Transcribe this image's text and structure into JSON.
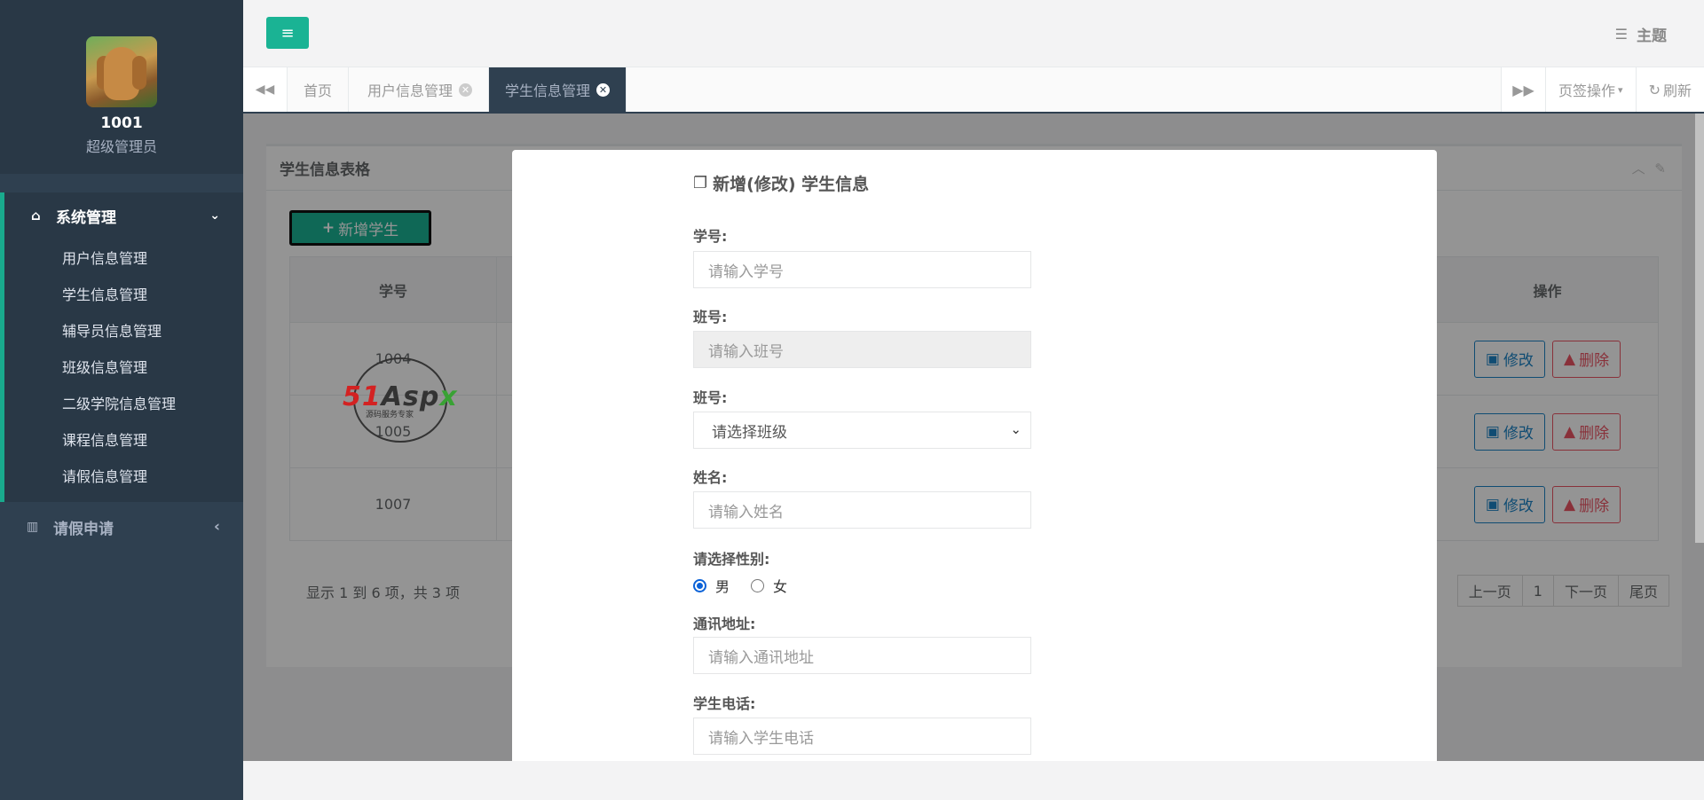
{
  "sidebar": {
    "user_id": "1001",
    "user_role": "超级管理员",
    "group": {
      "label": "系统管理",
      "icon": "home-icon"
    },
    "items": [
      {
        "label": "用户信息管理"
      },
      {
        "label": "学生信息管理"
      },
      {
        "label": "辅导员信息管理"
      },
      {
        "label": "班级信息管理"
      },
      {
        "label": "二级学院信息管理"
      },
      {
        "label": "课程信息管理"
      },
      {
        "label": "请假信息管理"
      }
    ],
    "leave": {
      "label": "请假申请",
      "icon": "bar-chart-icon"
    }
  },
  "topbar": {
    "theme_label": "主题"
  },
  "tabs": {
    "items": [
      {
        "label": "首页"
      },
      {
        "label": "用户信息管理"
      },
      {
        "label": "学生信息管理"
      }
    ],
    "ops_label": "页签操作",
    "refresh_label": "刷新"
  },
  "panel": {
    "title": "学生信息表格",
    "add_label": "新增学生",
    "columns": {
      "id": "学号",
      "ops": "操作"
    },
    "rows": [
      {
        "id": "1004"
      },
      {
        "id": "1005"
      },
      {
        "id": "1007"
      }
    ],
    "edit_label": "修改",
    "delete_label": "删除",
    "pager_info": "显示 1 到 6 项，共 3 项",
    "pager": {
      "prev": "上一页",
      "page": "1",
      "next": "下一页",
      "last": "尾页"
    }
  },
  "watermark": {
    "brand": "51Aspx",
    "sub": "源码服务专家"
  },
  "modal": {
    "title": "新增(修改) 学生信息",
    "fields": {
      "student_id": {
        "label": "学号:",
        "placeholder": "请输入学号"
      },
      "class_no": {
        "label": "班号:",
        "placeholder": "请输入班号"
      },
      "class_select": {
        "label": "班号:",
        "value": "请选择班级"
      },
      "name": {
        "label": "姓名:",
        "placeholder": "请输入姓名"
      },
      "gender": {
        "label": "请选择性别:",
        "male": "男",
        "female": "女",
        "selected": "男"
      },
      "address": {
        "label": "通讯地址:",
        "placeholder": "请输入通讯地址"
      },
      "phone": {
        "label": "学生电话:",
        "placeholder": "请输入学生电话"
      }
    }
  },
  "colors": {
    "accent": "#1ab394",
    "sidebar": "#2f4050",
    "edit": "#1c84c6",
    "delete": "#ed5565"
  }
}
